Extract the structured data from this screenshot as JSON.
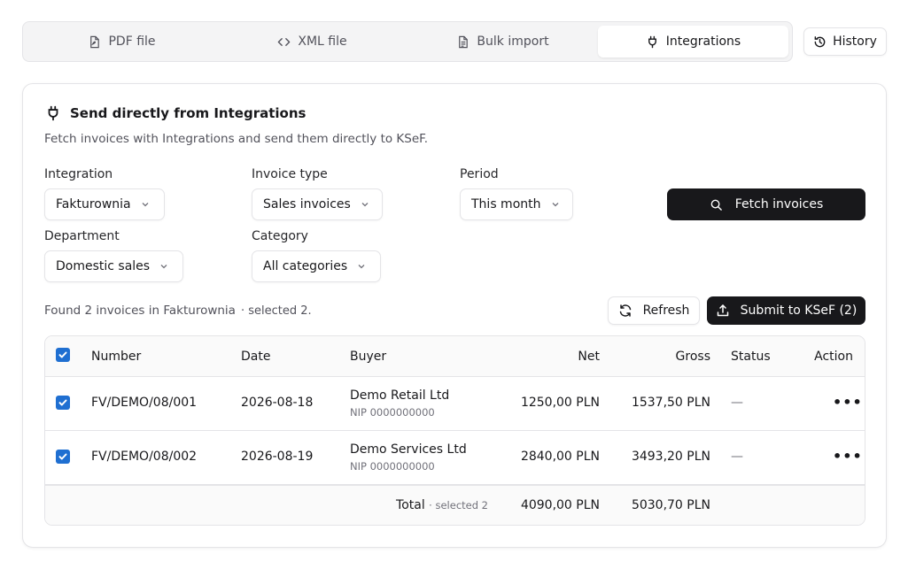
{
  "tabs": [
    {
      "label": "PDF file",
      "icon": "file-pdf-icon"
    },
    {
      "label": "XML file",
      "icon": "code-icon"
    },
    {
      "label": "Bulk import",
      "icon": "file-list-icon"
    },
    {
      "label": "Integrations",
      "icon": "plug-icon",
      "active": true
    }
  ],
  "history_label": "History",
  "card": {
    "title": "Send directly from Integrations",
    "subtitle": "Fetch invoices with Integrations and send them directly to KSeF."
  },
  "filters": {
    "integration": {
      "label": "Integration",
      "value": "Fakturownia"
    },
    "invoice_type": {
      "label": "Invoice type",
      "value": "Sales invoices"
    },
    "period": {
      "label": "Period",
      "value": "This month"
    },
    "department": {
      "label": "Department",
      "value": "Domestic sales"
    },
    "category": {
      "label": "Category",
      "value": "All categories"
    }
  },
  "fetch_label": "Fetch invoices",
  "found_text": "Found 2 invoices in Fakturownia",
  "selected_text": "· selected 2.",
  "refresh_label": "Refresh",
  "submit_label": "Submit to KSeF (2)",
  "table": {
    "headers": {
      "number": "Number",
      "date": "Date",
      "buyer": "Buyer",
      "net": "Net",
      "gross": "Gross",
      "status": "Status",
      "action": "Action"
    },
    "rows": [
      {
        "number": "FV/DEMO/08/001",
        "date": "2026-08-18",
        "buyer": "Demo Retail Ltd",
        "nip": "NIP 0000000000",
        "net": "1250,00 PLN",
        "gross": "1537,50 PLN",
        "status": "—",
        "action": "•••",
        "checked": true
      },
      {
        "number": "FV/DEMO/08/002",
        "date": "2026-08-19",
        "buyer": "Demo Services Ltd",
        "nip": "NIP 0000000000",
        "net": "2840,00 PLN",
        "gross": "3493,20 PLN",
        "status": "—",
        "action": "•••",
        "checked": true
      }
    ],
    "footer": {
      "label": "Total",
      "selected": "· selected 2",
      "net": "4090,00 PLN",
      "gross": "5030,70 PLN"
    }
  },
  "colors": {
    "accent": "#1f6fd1",
    "primary_button": "#18181b"
  }
}
